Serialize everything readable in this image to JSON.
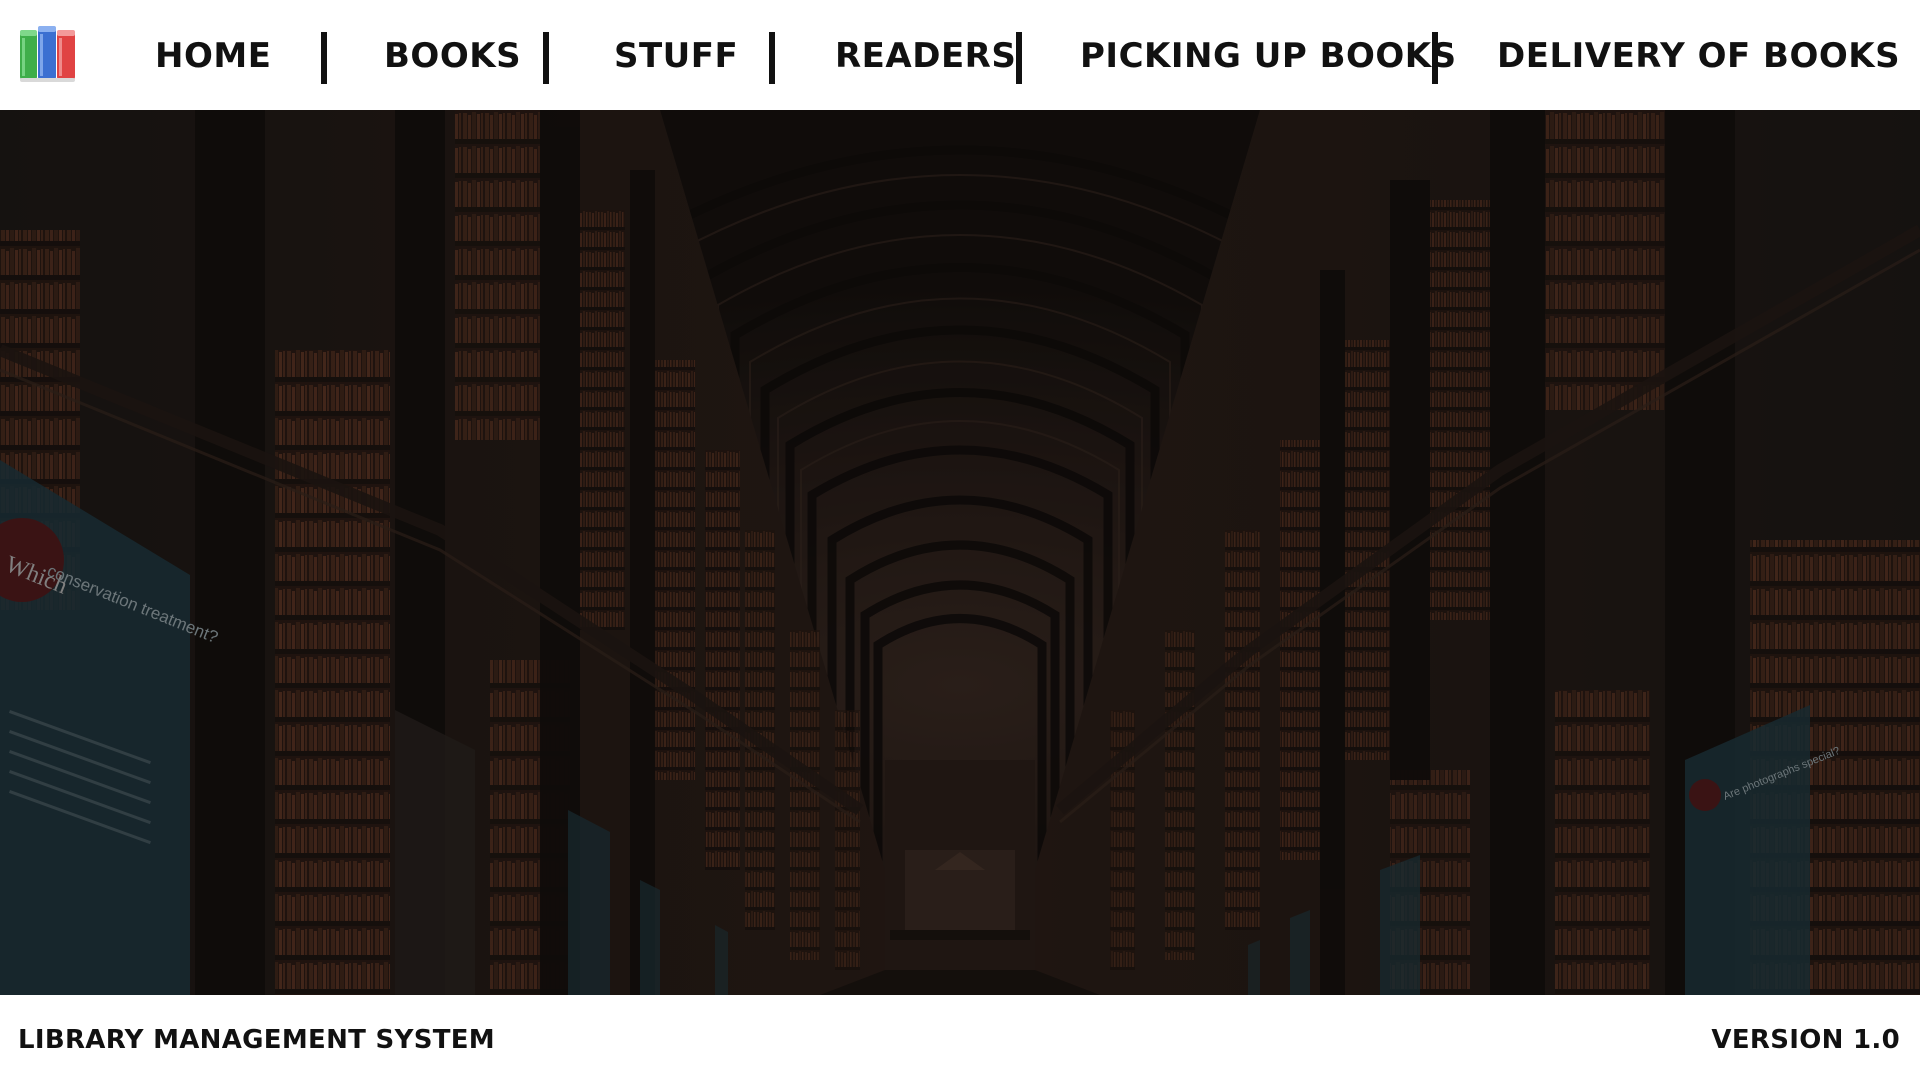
{
  "nav": {
    "items": [
      {
        "label": "HOME"
      },
      {
        "label": "BOOKS"
      },
      {
        "label": "STUFF"
      },
      {
        "label": "READERS"
      },
      {
        "label": "PICKING UP BOOKS"
      },
      {
        "label": "DELIVERY OF BOOKS"
      }
    ]
  },
  "hero": {
    "panel_heading": "Which conservation treatment?",
    "panel_heading_right": "Are photographs special?"
  },
  "footer": {
    "app_name": "LIBRARY MANAGEMENT SYSTEM",
    "version": "VERSION 1.0"
  },
  "colors": {
    "nav_text": "#111111",
    "hero_overlay": "#0b0908",
    "panel_blue": "#1c3a44",
    "shelf_brown": "#3a2418",
    "background": "#ffffff"
  },
  "icons": {
    "logo": "books-stack-icon"
  }
}
